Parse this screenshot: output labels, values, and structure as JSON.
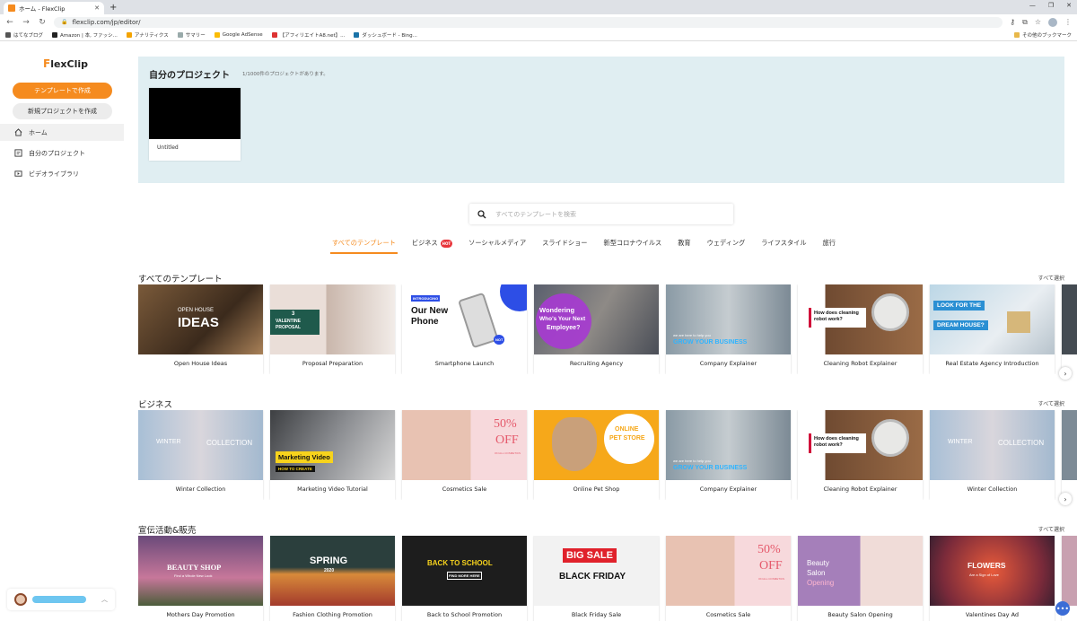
{
  "browser": {
    "tab_title": "ホーム - FlexClip",
    "url": "flexclip.com/jp/editor/",
    "bookmarks": [
      "はてなブログ",
      "Amazon | 本, ファッシ...",
      "アナリティクス",
      "サマリー",
      "Google AdSense",
      "【アフィリエイトA8.net】...",
      "ダッシュボード - Bing..."
    ],
    "other_bookmarks": "その他のブックマーク"
  },
  "sidebar": {
    "logo": "lexClip",
    "logo_mark": "F",
    "create_template": "テンプレートで作成",
    "new_project": "新規プロジェクトを作成",
    "items": [
      {
        "label": "ホーム"
      },
      {
        "label": "自分のプロジェクト"
      },
      {
        "label": "ビデオライブラリ"
      }
    ]
  },
  "projects": {
    "title": "自分のプロジェクト",
    "count": "1/1000件のプロジェクトがあります。",
    "items": [
      {
        "name": "Untitled"
      }
    ]
  },
  "search": {
    "placeholder": "すべてのテンプレートを検索"
  },
  "categories": [
    {
      "label": "すべてのテンプレート",
      "active": true
    },
    {
      "label": "ビジネス",
      "hot": "HOT"
    },
    {
      "label": "ソーシャルメディア"
    },
    {
      "label": "スライドショー"
    },
    {
      "label": "新型コロナウイルス"
    },
    {
      "label": "教育"
    },
    {
      "label": "ウェディング"
    },
    {
      "label": "ライフスタイル"
    },
    {
      "label": "旅行"
    }
  ],
  "select_all": "すべて選択",
  "rows": [
    {
      "title": "すべてのテンプレート",
      "cards": [
        {
          "name": "Open House Ideas",
          "line1": "OPEN HOUSE",
          "line2": "IDEAS"
        },
        {
          "name": "Proposal Preparation",
          "line1": "3",
          "line2": "VALENTINE",
          "line3": "PROPOSAL"
        },
        {
          "name": "Smartphone Launch",
          "badge": "INTRODUCING",
          "line1": "Our New",
          "line2": "Phone",
          "tag": "NOT"
        },
        {
          "name": "Recruiting Agency",
          "line1": "Wondering",
          "line2": "Who's Your Next",
          "line3": "Employee?"
        },
        {
          "name": "Company Explainer",
          "line1": "we are here to help you",
          "line2": "GROW YOUR BUSINESS"
        },
        {
          "name": "Cleaning Robot Explainer",
          "line1": "How does cleaning",
          "line2": "robot work?"
        },
        {
          "name": "Real Estate Agency Introduction",
          "line1": "LOOK FOR THE",
          "line2": "DREAM HOUSE?"
        }
      ]
    },
    {
      "title": "ビジネス",
      "cards": [
        {
          "name": "Winter Collection",
          "line1": "WINTER",
          "line2": "COLLECTION"
        },
        {
          "name": "Marketing Video Tutorial",
          "line1": "Marketing Video",
          "line2": "HOW TO CREATE"
        },
        {
          "name": "Cosmetics Sale",
          "line1": "50%",
          "line2": "OFF",
          "line3": "ON ALL COSMETICS"
        },
        {
          "name": "Online Pet Shop",
          "line1": "ONLINE",
          "line2": "PET STORE"
        },
        {
          "name": "Company Explainer",
          "line1": "we are here to help you",
          "line2": "GROW YOUR BUSINESS"
        },
        {
          "name": "Cleaning Robot Explainer",
          "line1": "How does cleaning",
          "line2": "robot work?"
        },
        {
          "name": "Winter Collection",
          "line1": "WINTER",
          "line2": "COLLECTION"
        }
      ]
    },
    {
      "title": "宣伝活動&販売",
      "cards": [
        {
          "name": "Mothers Day Promotion",
          "line1": "BEAUTY SHOP",
          "line2": "Find a Whole New Look"
        },
        {
          "name": "Fashion Clothing Promotion",
          "line1": "SPRING",
          "line2": "2020"
        },
        {
          "name": "Back to School Promotion",
          "line1": "BACK TO SCHOOL",
          "line2": "FIND MORE HERE"
        },
        {
          "name": "Black Friday Sale",
          "line1": "BIG SALE",
          "line2": "BLACK FRIDAY"
        },
        {
          "name": "Cosmetics Sale",
          "line1": "50%",
          "line2": "OFF",
          "line3": "ON ALL COSMETICS"
        },
        {
          "name": "Beauty Salon Opening",
          "line1": "Beauty",
          "line2": "Salon",
          "line3": "Opening"
        },
        {
          "name": "Valentines Day Ad",
          "line1": "FLOWERS",
          "line2": "Are a Sign of Love"
        }
      ]
    }
  ],
  "colors": {
    "accent": "#f58b1f",
    "panel_bg": "#e0eef2",
    "hot_badge": "#e8343a"
  }
}
